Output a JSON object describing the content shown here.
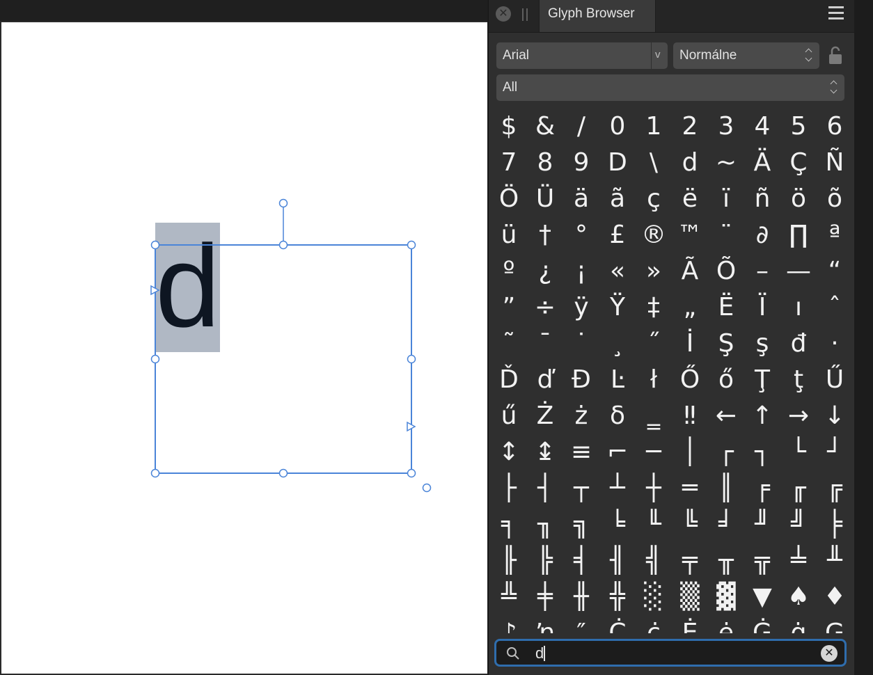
{
  "canvas": {
    "text_frame_content": "d"
  },
  "panel": {
    "title": "Glyph Browser",
    "close_glyph": "✕",
    "font_family": "Arial",
    "font_family_chevron": "v",
    "font_style": "Normálne",
    "category": "All",
    "search": {
      "value": "d",
      "clear_glyph": "✕"
    },
    "glyphs": [
      "$",
      "&",
      "/",
      "0",
      "1",
      "2",
      "3",
      "4",
      "5",
      "6",
      "7",
      "8",
      "9",
      "D",
      "\\",
      "d",
      "~",
      "Ä",
      "Ç",
      "Ñ",
      "Ö",
      "Ü",
      "ä",
      "ã",
      "ç",
      "ë",
      "ï",
      "ñ",
      "ö",
      "õ",
      "ü",
      "†",
      "°",
      "£",
      "®",
      "™",
      "¨",
      "∂",
      "∏",
      "ª",
      "º",
      "¿",
      "¡",
      "«",
      "»",
      "Ã",
      "Õ",
      "–",
      "—",
      "“",
      "”",
      "÷",
      "ÿ",
      "Ÿ",
      "‡",
      "„",
      "Ë",
      "Ï",
      "ı",
      "ˆ",
      "˜",
      "¯",
      "˙",
      "¸",
      "˝",
      "İ",
      "Ş",
      "ş",
      "đ",
      "·",
      "Ď",
      "ď",
      "Đ",
      "Ŀ",
      "ł",
      "Ő",
      "ő",
      "Ţ",
      "ţ",
      "Ű",
      "ű",
      "Ż",
      "ż",
      "δ",
      "‗",
      "‼",
      "←",
      "↑",
      "→",
      "↓",
      "↕",
      "↨",
      "≡",
      "⌐",
      "─",
      "│",
      "┌",
      "┐",
      "└",
      "┘",
      "├",
      "┤",
      "┬",
      "┴",
      "┼",
      "═",
      "║",
      "╒",
      "╓",
      "╔",
      "╕",
      "╖",
      "╗",
      "╘",
      "╙",
      "╚",
      "╛",
      "╜",
      "╝",
      "╞",
      "╟",
      "╠",
      "╡",
      "╢",
      "╣",
      "╤",
      "╥",
      "╦",
      "╧",
      "╨",
      "╩",
      "╪",
      "╫",
      "╬",
      "░",
      "▒",
      "▓",
      "▼",
      "♠",
      "♦",
      "♪",
      "ŉ",
      "″",
      "Ċ",
      "ċ",
      "Ė",
      "ė",
      "Ġ",
      "ġ",
      "Ģ"
    ]
  }
}
